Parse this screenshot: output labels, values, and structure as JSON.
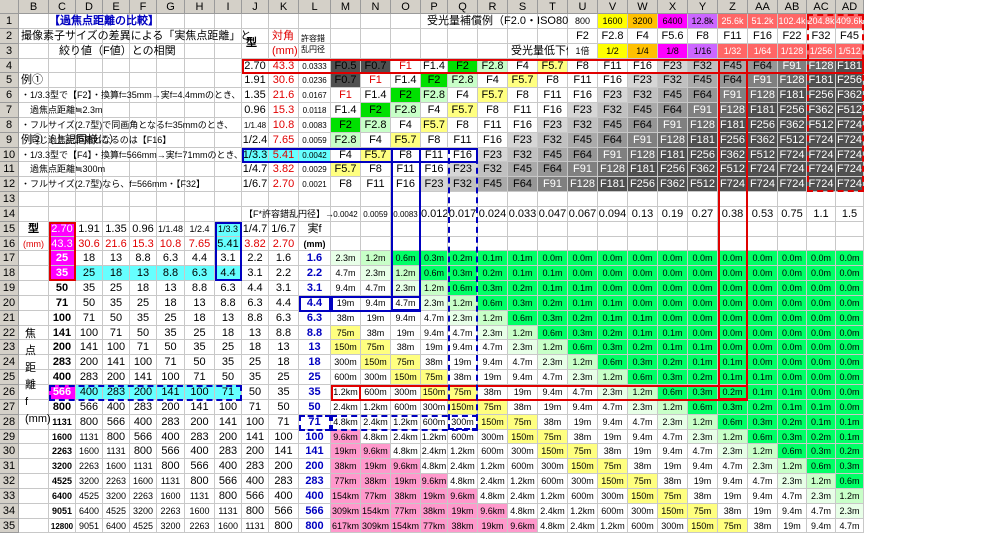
{
  "col_headers": [
    "B",
    "C",
    "D",
    "E",
    "F",
    "G",
    "H",
    "I",
    "J",
    "K",
    "L",
    "M",
    "N",
    "O",
    "P",
    "Q",
    "R",
    "S",
    "T",
    "U",
    "V",
    "W",
    "X",
    "Y",
    "Z",
    "AA",
    "AB",
    "AC",
    "AD"
  ],
  "row_headers": [
    "1",
    "2",
    "3",
    "4",
    "5",
    "6",
    "7",
    "8",
    "9",
    "10",
    "11",
    "12",
    "13",
    "14",
    "15",
    "16",
    "17",
    "18",
    "19",
    "20",
    "21",
    "22",
    "23",
    "24",
    "25",
    "26",
    "27",
    "28",
    "29",
    "30",
    "31",
    "32",
    "33",
    "34",
    "35"
  ],
  "colors": {
    "header": "#d4d0c8",
    "red": "#e00000",
    "blue": "#0000c0",
    "green": "#00e000",
    "lightgreen": "#c8ffc8",
    "yellow": "#ffff80",
    "pink": "#ff99cc",
    "magenta": "#ff00ff",
    "purple": "#cc66ff",
    "cyan": "#66ffff",
    "lightpink": "#ffe0e0",
    "dark": "#808080"
  },
  "title": "【過焦点距離の比較】",
  "subtitle1": "撮像素子サイズの差異による「実焦点距離」と",
  "subtitle2": "絞り値（F値）との相関",
  "label_type": "型",
  "label_diag": "対角",
  "label_mm": "(mm)",
  "label_coc1": "許容錯",
  "label_coc2": "乱円径",
  "row1_label": "受光量補償例（F2.0・ISO800の場合の感度）→",
  "row3_label": "受光量低下例（F2.0比）→",
  "row1_values": [
    "800",
    "1600",
    "3200",
    "6400",
    "12.8k",
    "25.6k",
    "51.2k",
    "102.4k",
    "204.8k",
    "409.6k"
  ],
  "row2_values": [
    "F2",
    "F2.8",
    "F4",
    "F5.6",
    "F8",
    "F11",
    "F16",
    "F22",
    "F32",
    "F45"
  ],
  "row3_values": [
    "1倍",
    "1/2",
    "1/4",
    "1/8",
    "1/16",
    "1/32",
    "1/64",
    "1/128",
    "1/256",
    "1/512"
  ],
  "example1": [
    "例①",
    "・1/3.3型で【F2】・換算f=35mm→実f=4.4mmのとき、",
    "　過焦点距離≒2.3m",
    "・フルサイズ(2.7型)で同画角となるf=35mmのとき、",
    "　同じ過焦点距離となるのは【F16】"
  ],
  "example2": [
    "例②（上記同様に）",
    "・1/3.3型で【F4】・換算f=566mm→実f=71mmのとき、",
    "　過焦点距離≒300m",
    "・フルサイズ(2.7型)なら、f=566mm・【F32】"
  ],
  "sensors": [
    [
      "2.70",
      "43.3",
      "0.0333"
    ],
    [
      "1.91",
      "30.6",
      "0.0236"
    ],
    [
      "1.35",
      "21.6",
      "0.0167"
    ],
    [
      "0.96",
      "15.3",
      "0.0118"
    ],
    [
      "1/1.48",
      "10.8",
      "0.0083"
    ],
    [
      "1/2.4",
      "7.65",
      "0.0059"
    ],
    [
      "1/3.3",
      "5.41",
      "0.0042"
    ],
    [
      "1/4.7",
      "3.82",
      "0.0029"
    ],
    [
      "1/6.7",
      "2.70",
      "0.0021"
    ]
  ],
  "fseries": [
    "F0.5",
    "F0.7",
    "F1",
    "F1.4",
    "F2",
    "F2.8",
    "F4",
    "F5.7",
    "F8",
    "F11",
    "F16",
    "F23",
    "F32",
    "F45",
    "F64",
    "F91",
    "F128",
    "F181",
    "F256",
    "F362",
    "F512",
    "F724"
  ],
  "row14_label": "【F*許容錯乱円径】→",
  "row14_values": [
    "0.0042",
    "0.0059",
    "0.0083",
    "0.012",
    "0.017",
    "0.024",
    "0.033",
    "0.047",
    "0.067",
    "0.094",
    "0.13",
    "0.19",
    "0.27",
    "0.38",
    "0.53",
    "0.75",
    "1.1",
    "1.5"
  ],
  "row15": [
    "2.70",
    "1.91",
    "1.35",
    "0.96",
    "1/1.48",
    "1/2.4",
    "1/3.3",
    "1/4.7",
    "1/6.7",
    "実f"
  ],
  "row16": [
    "43.3",
    "30.6",
    "21.6",
    "15.3",
    "10.8",
    "7.65",
    "5.41",
    "3.82",
    "2.70",
    "(mm)"
  ],
  "focal_rows": [
    [
      "25",
      "18",
      "13",
      "8.8",
      "6.3",
      "4.4",
      "3.1",
      "2.2",
      "1.6",
      "1.6"
    ],
    [
      "35",
      "25",
      "18",
      "13",
      "8.8",
      "6.3",
      "4.4",
      "3.1",
      "2.2",
      "2.2"
    ],
    [
      "50",
      "35",
      "25",
      "18",
      "13",
      "8.8",
      "6.3",
      "4.4",
      "3.1",
      "3.1"
    ],
    [
      "71",
      "50",
      "35",
      "25",
      "18",
      "13",
      "8.8",
      "6.3",
      "4.4",
      "4.4"
    ],
    [
      "100",
      "71",
      "50",
      "35",
      "25",
      "18",
      "13",
      "8.8",
      "6.3",
      "6.3"
    ],
    [
      "141",
      "100",
      "71",
      "50",
      "35",
      "25",
      "18",
      "13",
      "8.8",
      "8.8"
    ],
    [
      "200",
      "141",
      "100",
      "71",
      "50",
      "35",
      "25",
      "18",
      "13",
      "13"
    ],
    [
      "283",
      "200",
      "141",
      "100",
      "71",
      "50",
      "35",
      "25",
      "18",
      "18"
    ],
    [
      "400",
      "283",
      "200",
      "141",
      "100",
      "71",
      "50",
      "35",
      "25",
      "25"
    ],
    [
      "566",
      "400",
      "283",
      "200",
      "141",
      "100",
      "71",
      "50",
      "35",
      "35"
    ],
    [
      "800",
      "566",
      "400",
      "283",
      "200",
      "141",
      "100",
      "71",
      "50",
      "50"
    ],
    [
      "1131",
      "800",
      "566",
      "400",
      "283",
      "200",
      "141",
      "100",
      "71",
      "71"
    ],
    [
      "1600",
      "1131",
      "800",
      "566",
      "400",
      "283",
      "200",
      "141",
      "100",
      "100"
    ],
    [
      "2263",
      "1600",
      "1131",
      "800",
      "566",
      "400",
      "283",
      "200",
      "141",
      "141"
    ],
    [
      "3200",
      "2263",
      "1600",
      "1131",
      "800",
      "566",
      "400",
      "283",
      "200",
      "200"
    ],
    [
      "4525",
      "3200",
      "2263",
      "1600",
      "1131",
      "800",
      "566",
      "400",
      "283",
      "283"
    ],
    [
      "6400",
      "4525",
      "3200",
      "2263",
      "1600",
      "1131",
      "800",
      "566",
      "400",
      "400"
    ],
    [
      "9051",
      "6400",
      "4525",
      "3200",
      "2263",
      "1600",
      "1131",
      "800",
      "566",
      "566"
    ],
    [
      "12800",
      "9051",
      "6400",
      "4525",
      "3200",
      "2263",
      "1600",
      "1131",
      "800",
      "800"
    ]
  ],
  "side_label": [
    "焦",
    "点",
    "距",
    "離",
    "f",
    "(mm)"
  ],
  "distances": [
    "0.0m",
    "0.0m",
    "0.0m",
    "0.0m",
    "0.0m",
    "0.1m",
    "0.1m",
    "0.2m",
    "0.3m",
    "0.6m",
    "1.2m",
    "2.3m",
    "4.7m",
    "9.4m",
    "19m",
    "38m",
    "75m",
    "150m",
    "300m",
    "600m",
    "1.2km",
    "2.4km",
    "4.8km",
    "9.6km",
    "19km",
    "38km",
    "77km",
    "154km",
    "309km",
    "617km"
  ]
}
